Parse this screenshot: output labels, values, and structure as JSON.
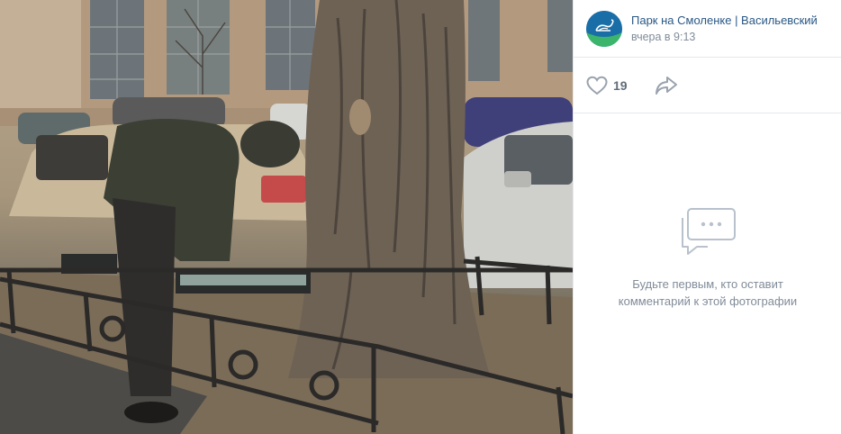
{
  "post": {
    "group_name": "Парк на Смоленке | Васильевский",
    "time": "вчера в 9:13",
    "likes": "19"
  },
  "comments": {
    "empty_line1": "Будьте первым, кто оставит",
    "empty_line2": "комментарий к этой фотографии"
  },
  "icons": {
    "like": "heart-outline-icon",
    "share": "share-arrow-icon",
    "comments": "comment-bubble-icon"
  },
  "colors": {
    "link": "#2a5885",
    "muted": "#818c99",
    "icon": "#99a2ad",
    "avatar": "#1a6ea8"
  }
}
